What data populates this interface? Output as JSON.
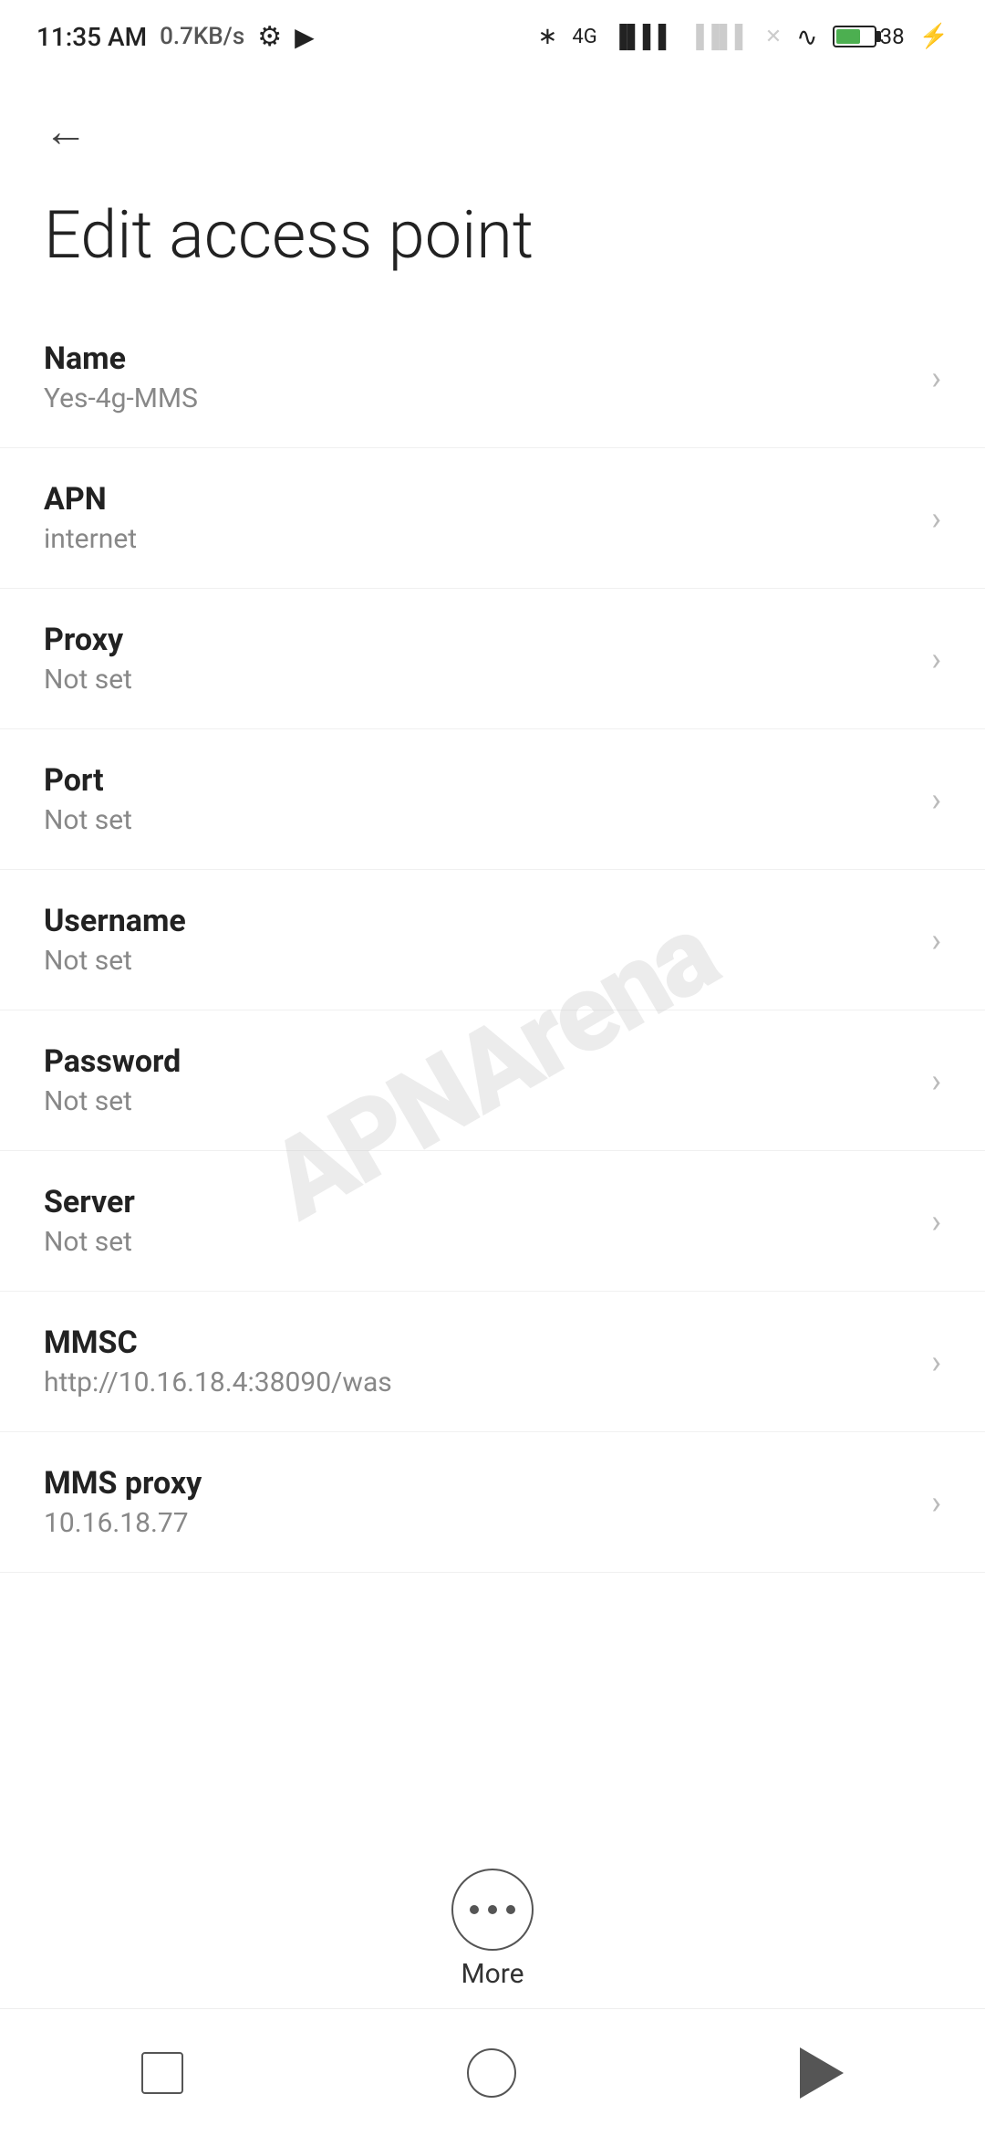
{
  "statusBar": {
    "time": "11:35 AM",
    "speed": "0.7KB/s"
  },
  "header": {
    "back_label": "←"
  },
  "page": {
    "title": "Edit access point"
  },
  "settings": [
    {
      "label": "Name",
      "value": "Yes-4g-MMS"
    },
    {
      "label": "APN",
      "value": "internet"
    },
    {
      "label": "Proxy",
      "value": "Not set"
    },
    {
      "label": "Port",
      "value": "Not set"
    },
    {
      "label": "Username",
      "value": "Not set"
    },
    {
      "label": "Password",
      "value": "Not set"
    },
    {
      "label": "Server",
      "value": "Not set"
    },
    {
      "label": "MMSC",
      "value": "http://10.16.18.4:38090/was"
    },
    {
      "label": "MMS proxy",
      "value": "10.16.18.77"
    }
  ],
  "more": {
    "label": "More"
  },
  "watermark": "APNArena"
}
